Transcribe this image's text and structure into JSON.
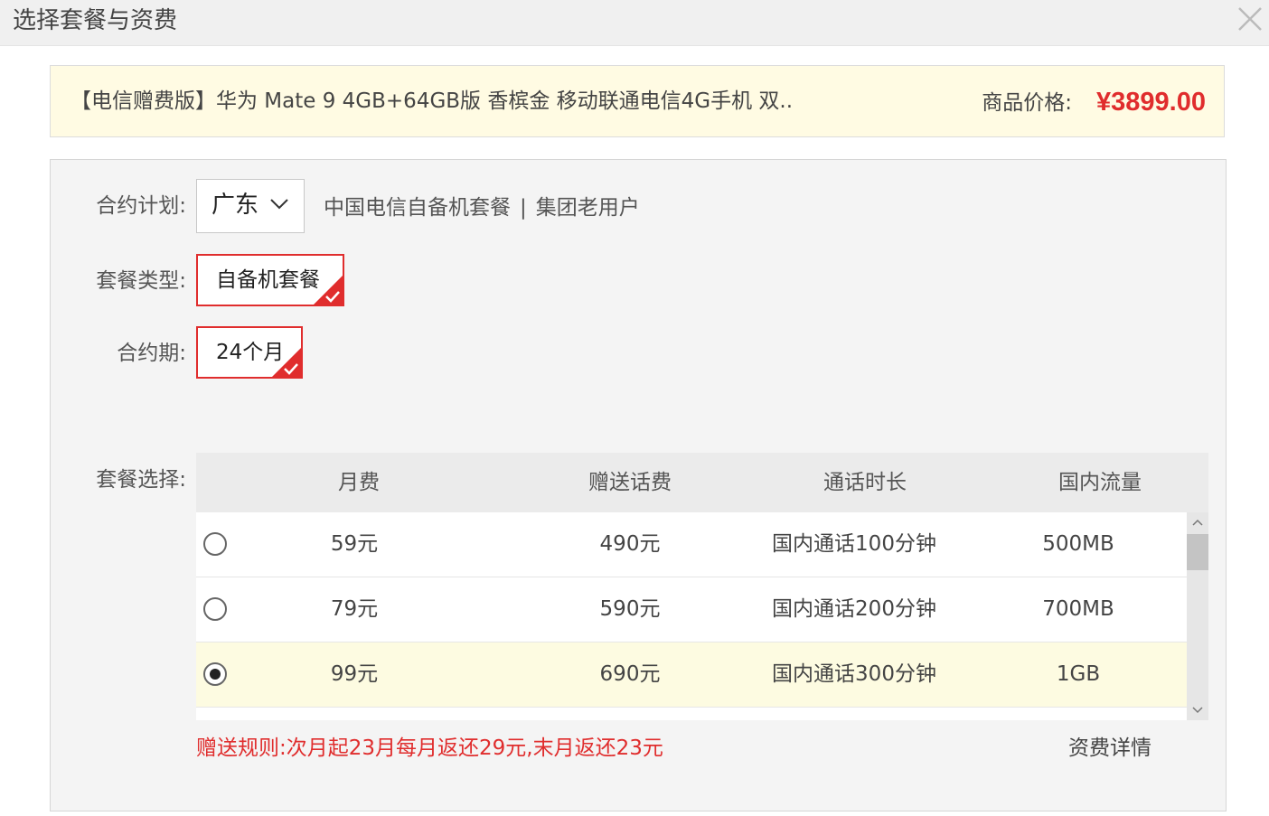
{
  "dialog": {
    "title": "选择套餐与资费"
  },
  "product": {
    "name": "【电信赠费版】华为 Mate 9 4GB+64GB版 香槟金 移动联通电信4G手机 双..",
    "price_label": "商品价格:",
    "price_value": "¥3899.00"
  },
  "contract_plan": {
    "label": "合约计划:",
    "province": "广东",
    "description_part1": "中国电信自备机套餐",
    "separator": "|",
    "description_part2": "集团老用户"
  },
  "package_type": {
    "label": "套餐类型:",
    "selected": "自备机套餐"
  },
  "contract_period": {
    "label": "合约期:",
    "selected": "24个月"
  },
  "package_select": {
    "label": "套餐选择:",
    "columns": [
      "月费",
      "赠送话费",
      "通话时长",
      "国内流量"
    ],
    "rows": [
      {
        "monthly": "59元",
        "bonus": "490元",
        "call": "国内通话100分钟",
        "data": "500MB",
        "selected": false
      },
      {
        "monthly": "79元",
        "bonus": "590元",
        "call": "国内通话200分钟",
        "data": "700MB",
        "selected": false
      },
      {
        "monthly": "99元",
        "bonus": "690元",
        "call": "国内通话300分钟",
        "data": "1GB",
        "selected": true
      }
    ]
  },
  "rule_text": "赠送规则:次月起23月每月返还29元,末月返还23元",
  "detail_link": "资费详情",
  "colors": {
    "accent": "#e02d2d",
    "product_bar_bg": "#fffbe3",
    "selected_row_bg": "#fdfbe1",
    "panel_bg": "#f4f4f4"
  },
  "icons": {
    "close": "close-icon",
    "dropdown": "chevron-down-icon",
    "selected_mark": "check-icon",
    "scroll_up": "chevron-up-icon",
    "scroll_down": "chevron-down-icon"
  }
}
